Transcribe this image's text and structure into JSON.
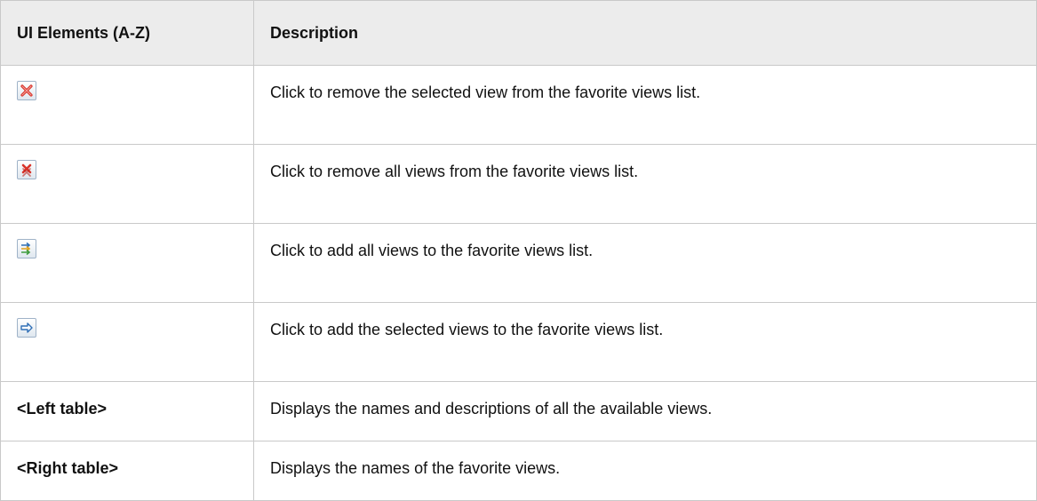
{
  "table": {
    "headers": [
      "UI Elements (A-Z)",
      "Description"
    ],
    "rows": [
      {
        "icon": "remove-selected-icon",
        "description": "Click to remove the selected view from the favorite views list."
      },
      {
        "icon": "remove-all-icon",
        "description": "Click to remove all views from the favorite views list."
      },
      {
        "icon": "add-all-icon",
        "description": "Click to add all views to the favorite views list."
      },
      {
        "icon": "add-selected-icon",
        "description": "Click to add the selected views to the favorite views list."
      },
      {
        "element": "<Left table>",
        "description": "Displays the names and descriptions of all the available views."
      },
      {
        "element": "<Right table>",
        "description": "Displays the names of the favorite views."
      }
    ]
  },
  "colors": {
    "header_bg": "#ececec",
    "border": "#c9c9c9",
    "remove_icon": "#d9342b",
    "add_icon": "#2f6fb6"
  }
}
